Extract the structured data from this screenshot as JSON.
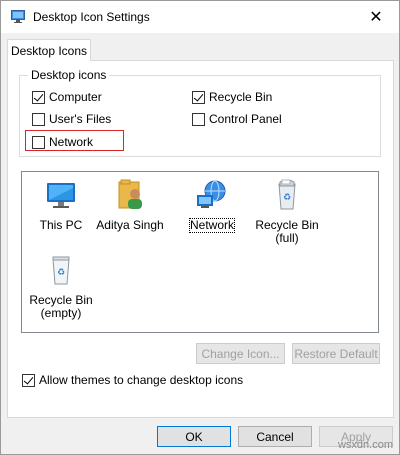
{
  "window": {
    "title": "Desktop Icon Settings",
    "close_glyph": "✕"
  },
  "tabs": [
    {
      "label": "Desktop Icons",
      "active": true
    }
  ],
  "desktop_icons_group": {
    "legend": "Desktop icons",
    "checkboxes": [
      {
        "label": "Computer",
        "checked": true
      },
      {
        "label": "Recycle Bin",
        "checked": true
      },
      {
        "label": "User's Files",
        "checked": false
      },
      {
        "label": "Control Panel",
        "checked": false
      },
      {
        "label": "Network",
        "checked": false
      }
    ]
  },
  "icon_list": [
    {
      "label": "This PC",
      "icon": "monitor-icon"
    },
    {
      "label": "Aditya Singh",
      "icon": "user-folder-icon"
    },
    {
      "label": "Network",
      "icon": "network-globe-icon",
      "selected": true
    },
    {
      "label": "Recycle Bin\n(full)",
      "label_line1": "Recycle Bin",
      "label_line2": "(full)",
      "icon": "recycle-bin-full-icon"
    },
    {
      "label": "Recycle Bin\n(empty)",
      "label_line1": "Recycle Bin",
      "label_line2": "(empty)",
      "icon": "recycle-bin-empty-icon"
    }
  ],
  "buttons": {
    "change_icon": "Change Icon...",
    "restore_default": "Restore Default",
    "ok": "OK",
    "cancel": "Cancel",
    "apply": "Apply"
  },
  "allow_themes": {
    "label": "Allow themes to change desktop icons",
    "checked": true
  },
  "watermark": "wsxdn.com",
  "colors": {
    "highlight_border": "#d9262b",
    "default_button_border": "#0078d7"
  }
}
